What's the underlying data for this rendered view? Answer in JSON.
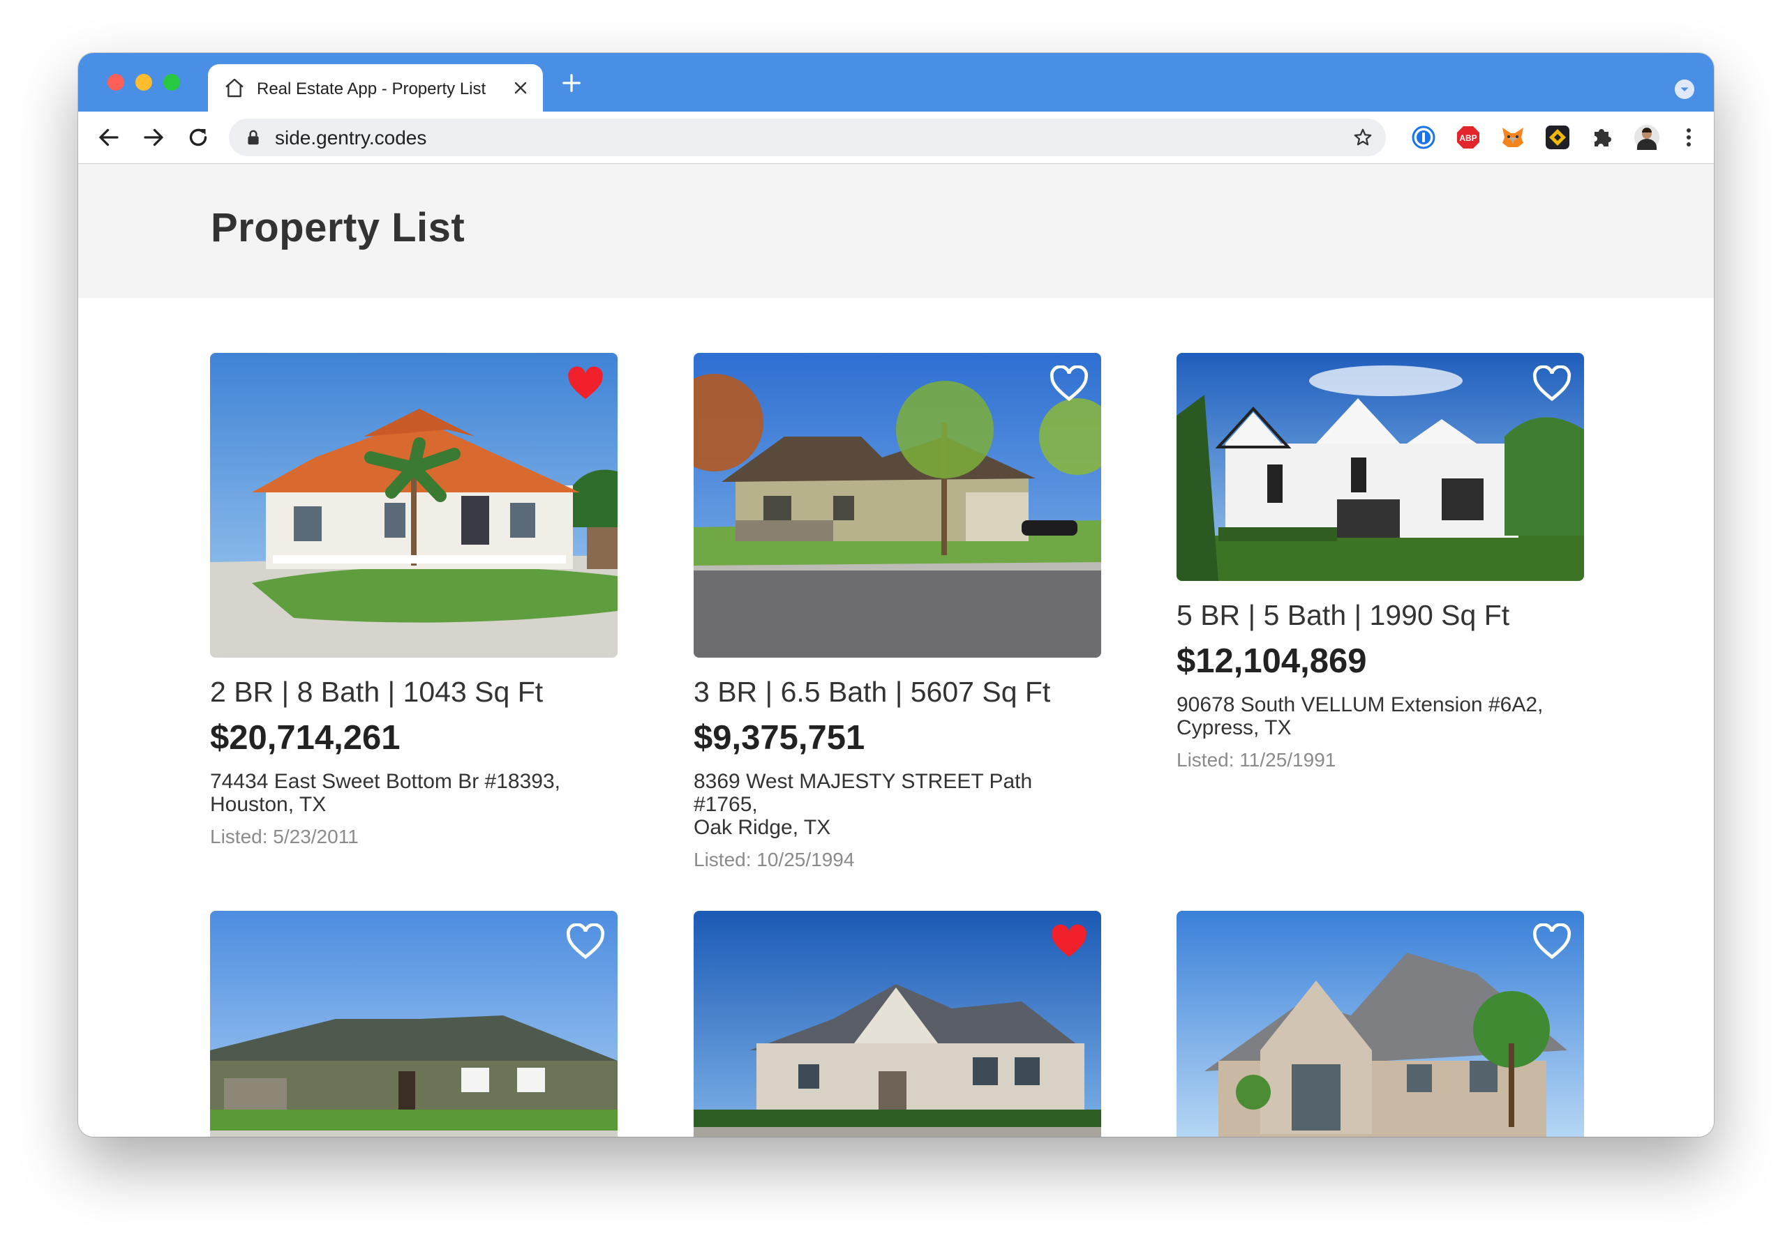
{
  "browser": {
    "tab_title": "Real Estate App - Property List",
    "url": "side.gentry.codes"
  },
  "extensions": [
    "1password-icon",
    "adblock-plus-icon",
    "metamask-fox-icon",
    "binance-wallet-icon",
    "puzzle-extensions-icon",
    "profile-avatar"
  ],
  "extension_labels": {
    "abp": "ABP"
  },
  "page": {
    "title": "Property List"
  },
  "listings": [
    {
      "specs": "2 BR | 8 Bath | 1043 Sq Ft",
      "price": "$20,714,261",
      "address_line1": "74434 East Sweet Bottom Br #18393,",
      "address_line2": "Houston, TX",
      "listed": "Listed: 5/23/2011",
      "favorite": true
    },
    {
      "specs": "3 BR | 6.5 Bath | 5607 Sq Ft",
      "price": "$9,375,751",
      "address_line1": "8369 West MAJESTY STREET Path #1765,",
      "address_line2": "Oak Ridge, TX",
      "listed": "Listed: 10/25/1994",
      "favorite": false
    },
    {
      "specs": "5 BR | 5 Bath | 1990 Sq Ft",
      "price": "$12,104,869",
      "address_line1": "90678 South VELLUM Extension #6A2,",
      "address_line2": "Cypress, TX",
      "listed": "Listed: 11/25/1991",
      "favorite": false
    },
    {
      "favorite": false
    },
    {
      "favorite": true
    },
    {
      "favorite": false
    }
  ],
  "colors": {
    "tab_strip": "#4a8fe6",
    "favorite_filled": "#f0212b",
    "favorite_outline": "#ffffff",
    "header_bg": "#f4f4f4"
  }
}
